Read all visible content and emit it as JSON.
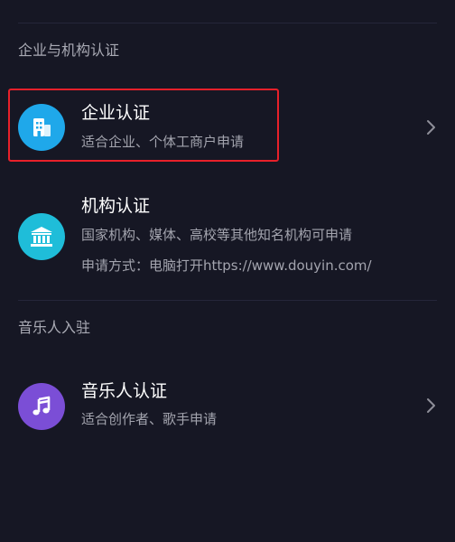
{
  "sections": [
    {
      "header": "企业与机构认证",
      "items": [
        {
          "title": "企业认证",
          "lines": [
            "适合企业、个体工商户申请"
          ],
          "icon": "building-icon",
          "icon_color": "#1fa8ea",
          "has_chevron": true,
          "highlighted": true
        },
        {
          "title": "机构认证",
          "lines": [
            "国家机构、媒体、高校等其他知名机构可申请",
            "申请方式：电脑打开https://www.douyin.com/"
          ],
          "icon": "institution-icon",
          "icon_color": "#1fbdd9",
          "has_chevron": false,
          "highlighted": false
        }
      ]
    },
    {
      "header": "音乐人入驻",
      "items": [
        {
          "title": "音乐人认证",
          "lines": [
            "适合创作者、歌手申请"
          ],
          "icon": "music-note-icon",
          "icon_color": "#7b4ed6",
          "has_chevron": true,
          "highlighted": false
        }
      ]
    }
  ],
  "colors": {
    "background": "#161724",
    "divider": "#25263a",
    "highlight_border": "#e8202a"
  }
}
